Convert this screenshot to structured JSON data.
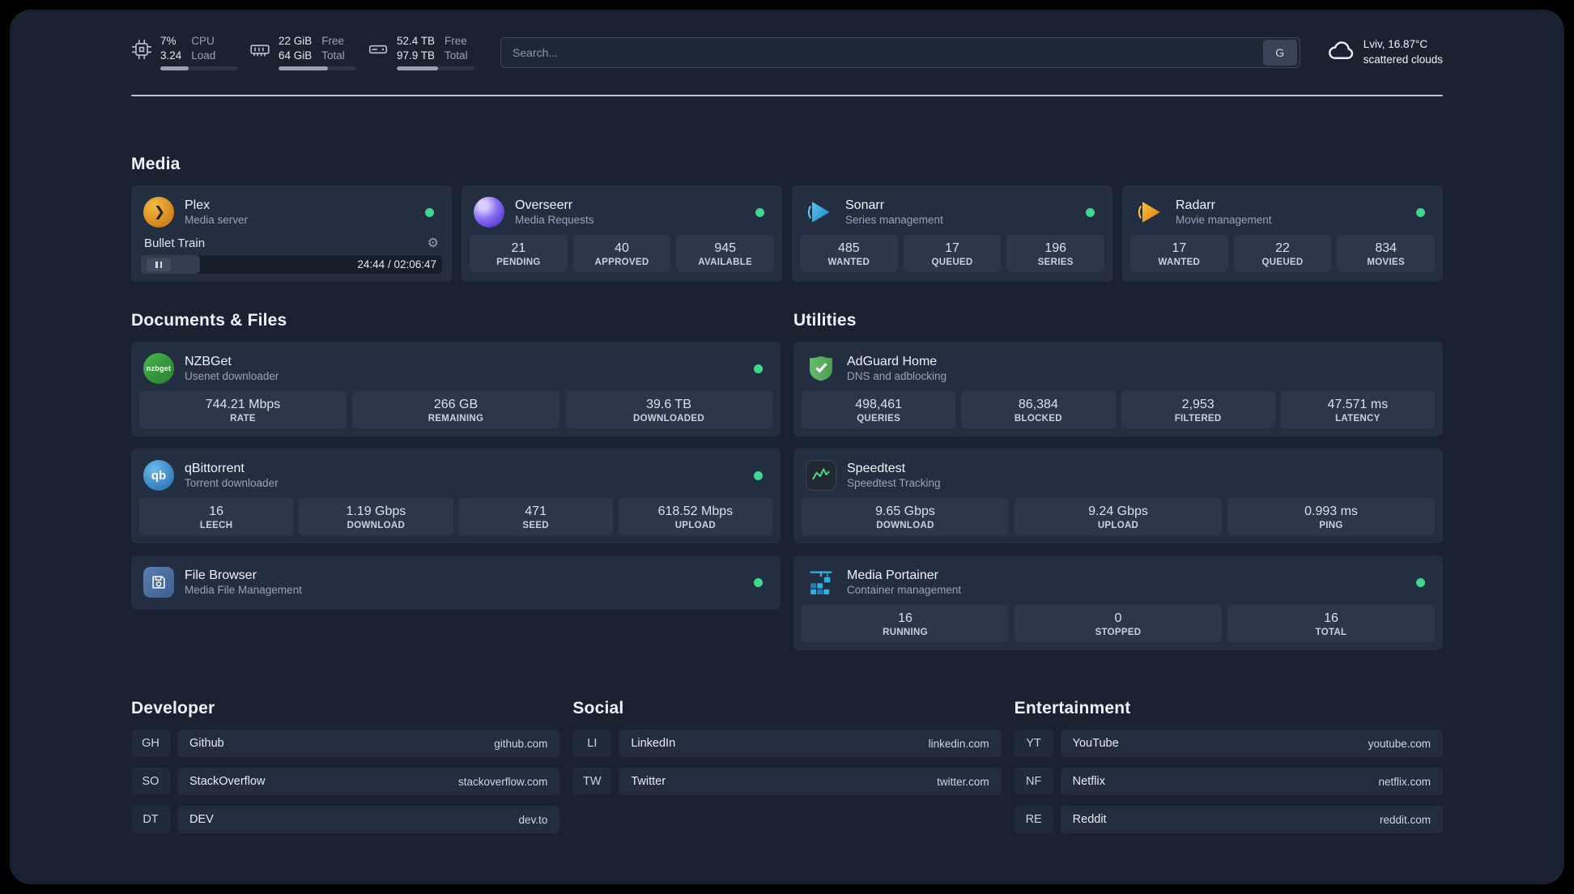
{
  "theme": {
    "status_online": "#3fd68f",
    "panel": "#1a2232",
    "card": "#242e41"
  },
  "header": {
    "cpu": {
      "value_top": "7%",
      "value_bottom": "3.24",
      "label_top": "CPU",
      "label_bottom": "Load",
      "bar_percent": 36
    },
    "memory": {
      "value_top": "22 GiB",
      "value_bottom": "64 GiB",
      "label_top": "Free",
      "label_bottom": "Total",
      "bar_percent": 64
    },
    "disk": {
      "value_top": "52.4 TB",
      "value_bottom": "97.9 TB",
      "label_top": "Free",
      "label_bottom": "Total",
      "bar_percent": 53
    },
    "search": {
      "placeholder": "Search...",
      "button_label": "G"
    },
    "weather": {
      "location": "Lviv, 16.87°C",
      "condition": "scattered clouds"
    }
  },
  "media": {
    "title": "Media",
    "plex": {
      "name": "Plex",
      "desc": "Media server",
      "player": {
        "track": "Bullet Train",
        "time": "24:44 / 02:06:47",
        "progress_percent": 19.5
      }
    },
    "overseerr": {
      "name": "Overseerr",
      "desc": "Media Requests",
      "stats": [
        {
          "value": "21",
          "label": "PENDING"
        },
        {
          "value": "40",
          "label": "APPROVED"
        },
        {
          "value": "945",
          "label": "AVAILABLE"
        }
      ]
    },
    "sonarr": {
      "name": "Sonarr",
      "desc": "Series management",
      "stats": [
        {
          "value": "485",
          "label": "WANTED"
        },
        {
          "value": "17",
          "label": "QUEUED"
        },
        {
          "value": "196",
          "label": "SERIES"
        }
      ]
    },
    "radarr": {
      "name": "Radarr",
      "desc": "Movie management",
      "stats": [
        {
          "value": "17",
          "label": "WANTED"
        },
        {
          "value": "22",
          "label": "QUEUED"
        },
        {
          "value": "834",
          "label": "MOVIES"
        }
      ]
    }
  },
  "documents": {
    "title": "Documents & Files",
    "nzbget": {
      "name": "NZBGet",
      "desc": "Usenet downloader",
      "stats": [
        {
          "value": "744.21 Mbps",
          "label": "RATE"
        },
        {
          "value": "266 GB",
          "label": "REMAINING"
        },
        {
          "value": "39.6 TB",
          "label": "DOWNLOADED"
        }
      ]
    },
    "qbittorrent": {
      "name": "qBittorrent",
      "desc": "Torrent downloader",
      "stats": [
        {
          "value": "16",
          "label": "LEECH"
        },
        {
          "value": "1.19 Gbps",
          "label": "DOWNLOAD"
        },
        {
          "value": "471",
          "label": "SEED"
        },
        {
          "value": "618.52 Mbps",
          "label": "UPLOAD"
        }
      ]
    },
    "filebrowser": {
      "name": "File Browser",
      "desc": "Media File Management"
    }
  },
  "utilities": {
    "title": "Utilities",
    "adguard": {
      "name": "AdGuard Home",
      "desc": "DNS and adblocking",
      "stats": [
        {
          "value": "498,461",
          "label": "QUERIES"
        },
        {
          "value": "86,384",
          "label": "BLOCKED"
        },
        {
          "value": "2,953",
          "label": "FILTERED"
        },
        {
          "value": "47.571 ms",
          "label": "LATENCY"
        }
      ]
    },
    "speedtest": {
      "name": "Speedtest",
      "desc": "Speedtest Tracking",
      "stats": [
        {
          "value": "9.65 Gbps",
          "label": "DOWNLOAD"
        },
        {
          "value": "9.24 Gbps",
          "label": "UPLOAD"
        },
        {
          "value": "0.993 ms",
          "label": "PING"
        }
      ]
    },
    "portainer": {
      "name": "Media Portainer",
      "desc": "Container management",
      "stats": [
        {
          "value": "16",
          "label": "RUNNING"
        },
        {
          "value": "0",
          "label": "STOPPED"
        },
        {
          "value": "16",
          "label": "TOTAL"
        }
      ]
    }
  },
  "bookmarks": {
    "developer": {
      "title": "Developer",
      "items": [
        {
          "abbr": "GH",
          "name": "Github",
          "url": "github.com"
        },
        {
          "abbr": "SO",
          "name": "StackOverflow",
          "url": "stackoverflow.com"
        },
        {
          "abbr": "DT",
          "name": "DEV",
          "url": "dev.to"
        }
      ]
    },
    "social": {
      "title": "Social",
      "items": [
        {
          "abbr": "LI",
          "name": "LinkedIn",
          "url": "linkedin.com"
        },
        {
          "abbr": "TW",
          "name": "Twitter",
          "url": "twitter.com"
        }
      ]
    },
    "entertainment": {
      "title": "Entertainment",
      "items": [
        {
          "abbr": "YT",
          "name": "YouTube",
          "url": "youtube.com"
        },
        {
          "abbr": "NF",
          "name": "Netflix",
          "url": "netflix.com"
        },
        {
          "abbr": "RE",
          "name": "Reddit",
          "url": "reddit.com"
        }
      ]
    }
  },
  "glyphs": {
    "plex": "❯",
    "qbittorrent": "qb",
    "nzbget": "nzbget",
    "gear": "⚙"
  }
}
